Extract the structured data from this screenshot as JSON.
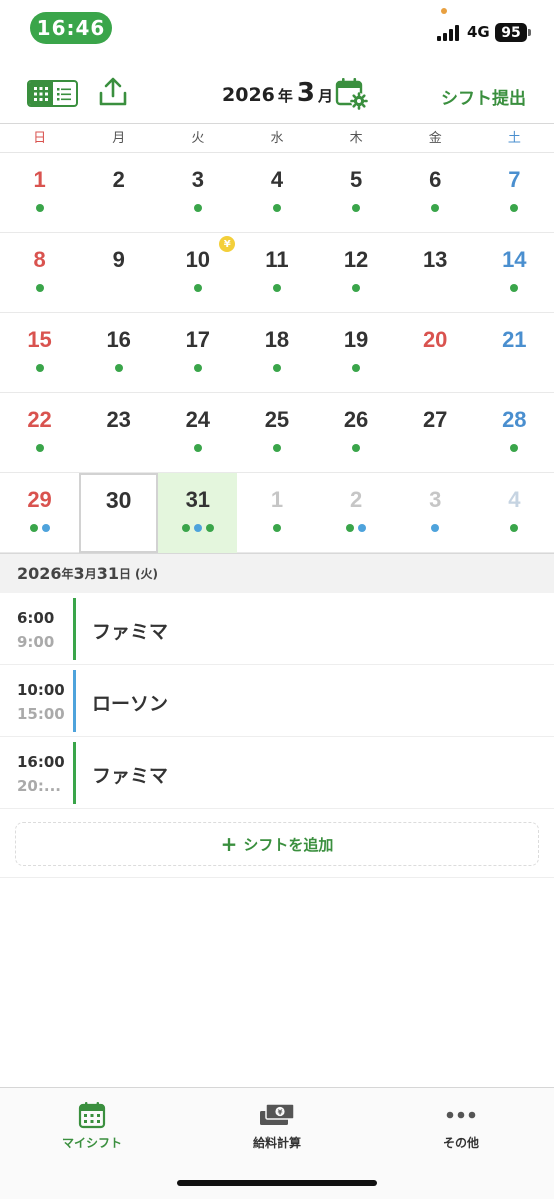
{
  "status_bar": {
    "time": "16:46",
    "network": "4G",
    "battery": "95"
  },
  "header": {
    "year": "2026",
    "year_unit": "年",
    "month": "3",
    "month_unit": "月",
    "submit_label": "シフト提出"
  },
  "weekdays": [
    "日",
    "月",
    "火",
    "水",
    "木",
    "金",
    "土"
  ],
  "calendar": {
    "weeks": [
      [
        {
          "d": "1",
          "dots": [
            "g"
          ]
        },
        {
          "d": "2",
          "dots": []
        },
        {
          "d": "3",
          "dots": [
            "g"
          ]
        },
        {
          "d": "4",
          "dots": [
            "g"
          ]
        },
        {
          "d": "5",
          "dots": [
            "g"
          ]
        },
        {
          "d": "6",
          "dots": [
            "g"
          ]
        },
        {
          "d": "7",
          "dots": [
            "g"
          ]
        }
      ],
      [
        {
          "d": "8",
          "dots": [
            "g"
          ]
        },
        {
          "d": "9",
          "dots": []
        },
        {
          "d": "10",
          "dots": [
            "g"
          ],
          "coin": "¥"
        },
        {
          "d": "11",
          "dots": [
            "g"
          ]
        },
        {
          "d": "12",
          "dots": [
            "g"
          ]
        },
        {
          "d": "13",
          "dots": []
        },
        {
          "d": "14",
          "dots": [
            "g"
          ]
        }
      ],
      [
        {
          "d": "15",
          "dots": [
            "g"
          ]
        },
        {
          "d": "16",
          "dots": [
            "g"
          ]
        },
        {
          "d": "17",
          "dots": [
            "g"
          ]
        },
        {
          "d": "18",
          "dots": [
            "g"
          ]
        },
        {
          "d": "19",
          "dots": [
            "g"
          ]
        },
        {
          "d": "20",
          "dots": [],
          "holiday": true
        },
        {
          "d": "21",
          "dots": []
        }
      ],
      [
        {
          "d": "22",
          "dots": [
            "g"
          ]
        },
        {
          "d": "23",
          "dots": []
        },
        {
          "d": "24",
          "dots": [
            "g"
          ]
        },
        {
          "d": "25",
          "dots": [
            "g"
          ]
        },
        {
          "d": "26",
          "dots": [
            "g"
          ]
        },
        {
          "d": "27",
          "dots": []
        },
        {
          "d": "28",
          "dots": [
            "g"
          ]
        }
      ],
      [
        {
          "d": "29",
          "dots": [
            "g",
            "b"
          ]
        },
        {
          "d": "30",
          "dots": [],
          "today": true
        },
        {
          "d": "31",
          "dots": [
            "g",
            "b",
            "g"
          ],
          "selected": true
        },
        {
          "d": "1",
          "dots": [
            "g"
          ],
          "other": true
        },
        {
          "d": "2",
          "dots": [
            "g",
            "b"
          ],
          "other": true
        },
        {
          "d": "3",
          "dots": [
            "b"
          ],
          "other": true
        },
        {
          "d": "4",
          "dots": [
            "g"
          ],
          "other": true
        }
      ]
    ]
  },
  "selected_date": {
    "year": "2026",
    "year_unit": "年",
    "month": "3",
    "month_unit": "月",
    "day": "31",
    "day_unit": "日",
    "weekday": "(火)"
  },
  "shifts": [
    {
      "start": "6:00",
      "end": "9:00",
      "place": "ファミマ",
      "color": "#3aa54a"
    },
    {
      "start": "10:00",
      "end": "15:00",
      "place": "ローソン",
      "color": "#4ea3dc"
    },
    {
      "start": "16:00",
      "end": "20:...",
      "place": "ファミマ",
      "color": "#3aa54a"
    }
  ],
  "add_shift_label": "シフトを追加",
  "tabs": [
    {
      "label": "マイシフト",
      "icon": "calendar-icon",
      "active": true
    },
    {
      "label": "給料計算",
      "icon": "money-icon",
      "active": false
    },
    {
      "label": "その他",
      "icon": "more-icon",
      "active": false
    }
  ],
  "colors": {
    "accent": "#3a8f3e",
    "green_dot": "#3aa54a",
    "blue_dot": "#4ea3dc",
    "sunday": "#d9534f",
    "saturday": "#4a8fcf"
  }
}
